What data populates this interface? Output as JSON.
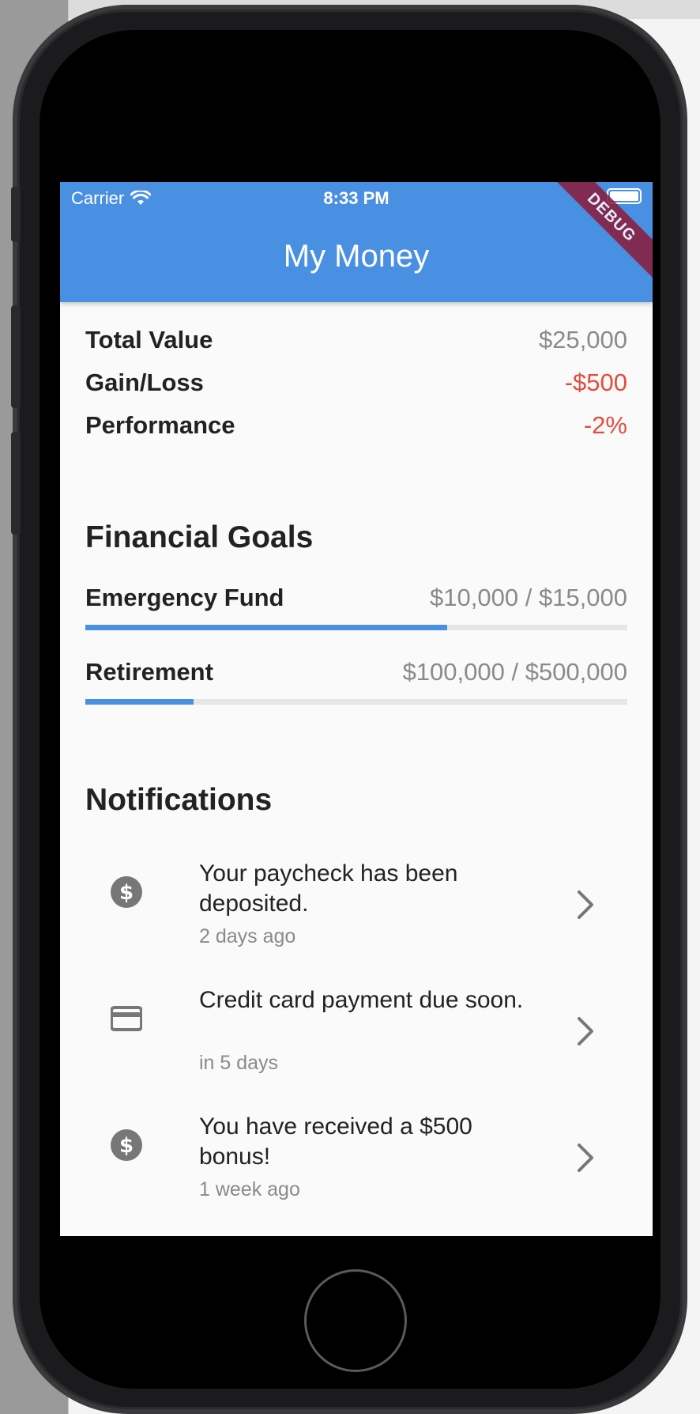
{
  "status_bar": {
    "carrier": "Carrier",
    "time": "8:33 PM"
  },
  "app_bar": {
    "title": "My Money",
    "debug_label": "DEBUG",
    "color": "#4a90e2"
  },
  "summary": [
    {
      "label": "Total Value",
      "value": "$25,000",
      "tone": "neutral"
    },
    {
      "label": "Gain/Loss",
      "value": "-$500",
      "tone": "negative"
    },
    {
      "label": "Performance",
      "value": "-2%",
      "tone": "negative"
    }
  ],
  "goals": {
    "title": "Financial Goals",
    "items": [
      {
        "name": "Emergency Fund",
        "amount": "$10,000 / $15,000",
        "progress": 0.667
      },
      {
        "name": "Retirement",
        "amount": "$100,000 / $500,000",
        "progress": 0.2
      }
    ]
  },
  "notifications": {
    "title": "Notifications",
    "items": [
      {
        "icon": "dollar-icon",
        "message": "Your paycheck has been deposited.",
        "time": "2 days ago"
      },
      {
        "icon": "credit-card-icon",
        "message": "Credit card payment due soon.",
        "time": "in 5 days"
      },
      {
        "icon": "dollar-icon",
        "message": "You have received a $500 bonus!",
        "time": "1 week ago"
      }
    ]
  },
  "colors": {
    "negative": "#e34c3c",
    "accent": "#4a90e2",
    "muted": "#8a8a8a"
  }
}
